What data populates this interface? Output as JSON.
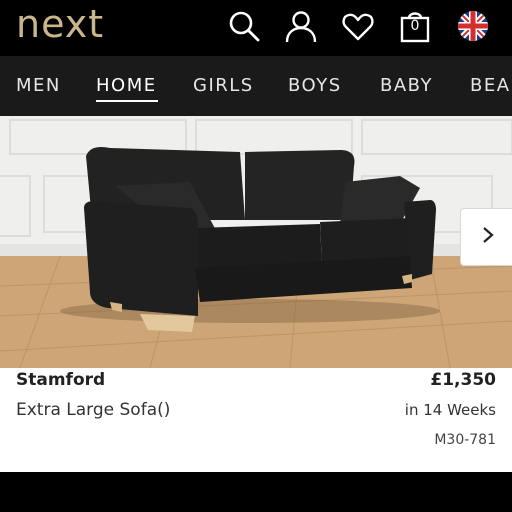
{
  "header": {
    "logo": "next",
    "icons": [
      "search-icon",
      "account-icon",
      "heart-icon",
      "bag-icon",
      "uk-flag-icon"
    ],
    "bag_count": "0",
    "accent_color": "#c9b68a"
  },
  "nav": {
    "items": [
      {
        "label": "MEN"
      },
      {
        "label": "HOME",
        "active": true
      },
      {
        "label": "GIRLS"
      },
      {
        "label": "BOYS"
      },
      {
        "label": "BABY"
      },
      {
        "label": "BEAUTY"
      }
    ]
  },
  "hero": {
    "next_icon": "chevron-right-icon"
  },
  "product": {
    "name": "Stamford",
    "price": "£1,350",
    "description": "Extra Large Sofa()",
    "delivery": "in 14 Weeks",
    "code": "M30-781"
  }
}
